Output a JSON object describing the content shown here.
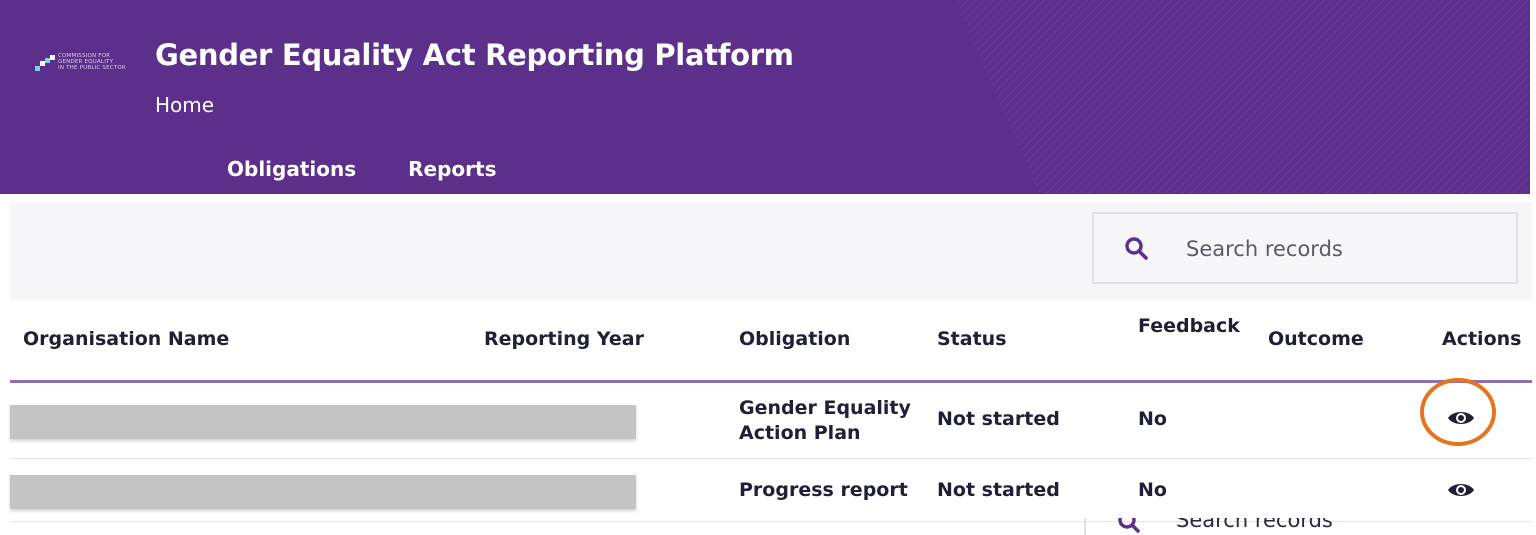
{
  "header": {
    "logo_text": [
      "COMMISSION FOR",
      "GENDER EQUALITY",
      "IN THE PUBLIC SECTOR"
    ],
    "title": "Gender Equality Act Reporting Platform",
    "breadcrumb": "Home",
    "nav": [
      {
        "label": "Obligations",
        "active": true
      },
      {
        "label": "Reports",
        "active": false
      }
    ]
  },
  "search": {
    "placeholder": "Search records",
    "value": ""
  },
  "table": {
    "columns": [
      "Organisation Name",
      "Reporting Year",
      "Obligation",
      "Status",
      "Feedback",
      "Outcome",
      "Actions"
    ],
    "rows": [
      {
        "organisation": "",
        "reporting_year": "",
        "obligation_line1": "Gender Equality",
        "obligation_line2": "Action Plan",
        "status": "Not started",
        "feedback": "No",
        "outcome": "",
        "action_icon": "eye-icon",
        "highlighted": true
      },
      {
        "organisation": "",
        "reporting_year": "",
        "obligation_line1": "Progress report",
        "obligation_line2": "",
        "status": "Not started",
        "feedback": "No",
        "outcome": "",
        "action_icon": "eye-icon",
        "highlighted": false
      }
    ]
  },
  "overlay": {
    "ghost_search_text": "Search records"
  },
  "colors": {
    "header_bg": "#5c2f8a",
    "header_line": "#8f6fb0",
    "highlight": "#e8731d",
    "search_icon": "#5c2f8a"
  }
}
